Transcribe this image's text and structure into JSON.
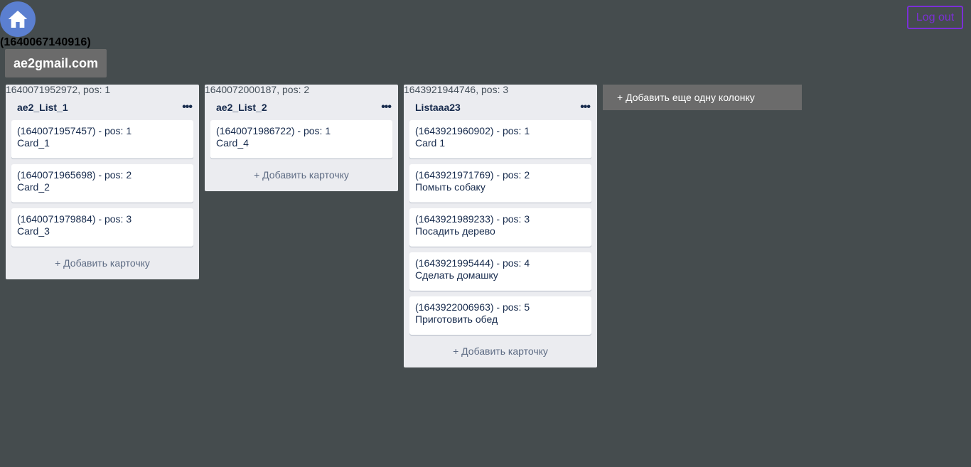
{
  "header": {
    "user_id": "(1640067140916)",
    "email": "ae2gmail.com",
    "logout_label": "Log out",
    "home_icon": "home-icon"
  },
  "columns": [
    {
      "meta": "1640071952972, pos: 1",
      "title": "ae2_List_1",
      "more_label": "•••",
      "cards": [
        {
          "meta": "(1640071957457) - pos: 1",
          "title": "Card_1"
        },
        {
          "meta": "(1640071965698) - pos: 2",
          "title": "Card_2"
        },
        {
          "meta": "(1640071979884) - pos: 3",
          "title": "Card_3"
        }
      ],
      "add_card_label": "+ Добавить карточку"
    },
    {
      "meta": "1640072000187, pos: 2",
      "title": "ae2_List_2",
      "more_label": "•••",
      "cards": [
        {
          "meta": "(1640071986722) - pos: 1",
          "title": "Card_4"
        }
      ],
      "add_card_label": "+ Добавить карточку"
    },
    {
      "meta": "1643921944746, pos: 3",
      "title": "Listaaa23",
      "more_label": "•••",
      "cards": [
        {
          "meta": "(1643921960902) - pos: 1",
          "title": "Card 1"
        },
        {
          "meta": "(1643921971769) - pos: 2",
          "title": "Помыть собаку"
        },
        {
          "meta": "(1643921989233) - pos: 3",
          "title": "Посадить дерево"
        },
        {
          "meta": "(1643921995444) - pos: 4",
          "title": "Сделать домашку"
        },
        {
          "meta": "(1643922006963) - pos: 5",
          "title": "Приготовить обед"
        }
      ],
      "add_card_label": "+ Добавить карточку"
    }
  ],
  "add_column_label": "+ Добавить еще одну колонку",
  "colors": {
    "background": "#454c4e",
    "accent": "#7b2fd6",
    "home_button": "#5b7fd0",
    "column_bg": "#ebecf0",
    "button_gray": "#6b6b6b"
  }
}
